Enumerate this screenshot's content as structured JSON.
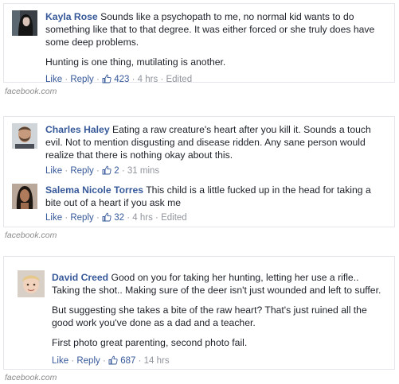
{
  "source_label": "facebook.com",
  "colors": {
    "link": "#365899",
    "text": "#1d2129",
    "meta": "#90949c",
    "border": "#e4e6eb"
  },
  "cards": [
    {
      "comments": [
        {
          "author": "Kayla Rose",
          "paragraphs": [
            "Sounds like a psychopath to me, no normal kid wants to do something like that to that degree. It was either forced or she truly does have some deep problems.",
            "Hunting is one thing, mutilating is another."
          ],
          "actions": {
            "like": "Like",
            "reply": "Reply",
            "likes_count": "423",
            "time": "4 hrs",
            "edited": "Edited"
          },
          "avatar_icon": "avatar-dark-hair"
        }
      ]
    },
    {
      "comments": [
        {
          "author": "Charles Haley",
          "paragraphs": [
            "Eating a raw creature's heart after you kill it. Sounds a touch evil. Not to mention disgusting and disease ridden. Any sane person would realize that there is nothing okay about this."
          ],
          "actions": {
            "like": "Like",
            "reply": "Reply",
            "likes_count": "2",
            "time": "31 mins"
          },
          "avatar_icon": "avatar-bearded-man"
        },
        {
          "author": "Salema Nicole Torres",
          "paragraphs": [
            "This child is a little fucked up in the head for taking a bite out of a heart if you ask me"
          ],
          "actions": {
            "like": "Like",
            "reply": "Reply",
            "likes_count": "32",
            "time": "4 hrs",
            "edited": "Edited"
          },
          "avatar_icon": "avatar-woman"
        }
      ]
    },
    {
      "comments": [
        {
          "author": "David Creed",
          "paragraphs": [
            "Good on you for taking her hunting, letting her use a rifle.. Taking the shot.. Making sure of the deer isn't just wounded and left to suffer.",
            "But suggesting she takes a bite of the raw heart? That's just ruined all the good work you've done as a dad and a teacher.",
            "First photo great parenting, second photo fail."
          ],
          "actions": {
            "like": "Like",
            "reply": "Reply",
            "likes_count": "687",
            "time": "14 hrs"
          },
          "avatar_icon": "avatar-child"
        }
      ]
    }
  ]
}
